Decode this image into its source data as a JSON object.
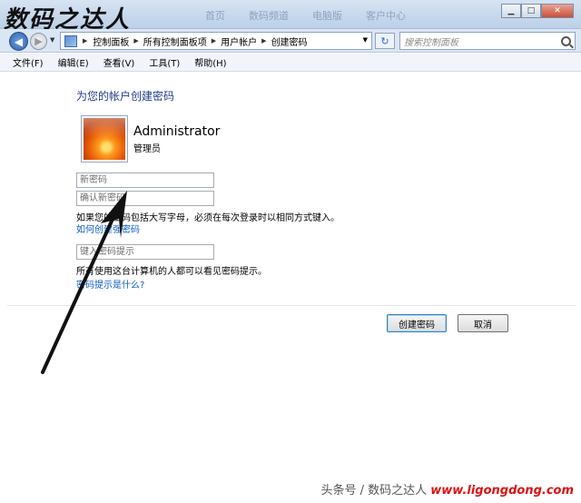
{
  "titlebar": {
    "watermark": "数码之达人",
    "ghost_tabs": [
      "首页",
      "数码频道",
      "电脑版",
      "客户中心"
    ]
  },
  "navbar": {
    "breadcrumb": [
      "控制面板",
      "所有控制面板项",
      "用户帐户",
      "创建密码"
    ],
    "search_placeholder": "搜索控制面板"
  },
  "menu": {
    "items": [
      "文件(F)",
      "编辑(E)",
      "查看(V)",
      "工具(T)",
      "帮助(H)"
    ]
  },
  "main": {
    "heading": "为您的帐户创建密码",
    "user": {
      "name": "Administrator",
      "role": "管理员"
    },
    "new_password_placeholder": "新密码",
    "confirm_password_placeholder": "确认新密码",
    "caps_note": "如果您的密码包括大写字母，必须在每次登录时以相同方式键入。",
    "strong_password_link": "如何创建强密码",
    "hint_placeholder": "键入密码提示",
    "hint_note": "所有使用这台计算机的人都可以看见密码提示。",
    "hint_link": "密码提示是什么?",
    "create_button": "创建密码",
    "cancel_button": "取消"
  },
  "footer": {
    "watermark_prefix": "头条号 / 数码之达人",
    "watermark_url": "www.ligongdong.com"
  },
  "colors": {
    "link": "#0b5bbf",
    "heading": "#1e3f8a",
    "close_button": "#c7503a"
  }
}
